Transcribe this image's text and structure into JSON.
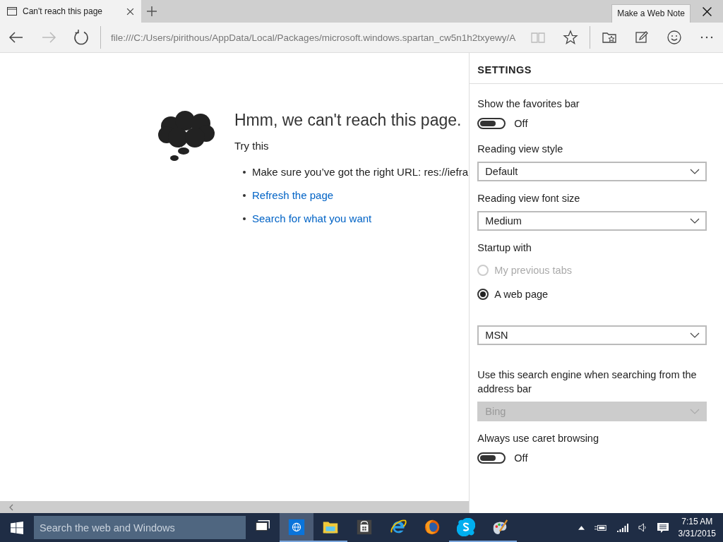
{
  "tabs": [
    {
      "title": "Can't reach this page",
      "selected": true
    }
  ],
  "address_bar": {
    "value": "file:///C:/Users/pirithous/AppData/Local/Packages/microsoft.windows.spartan_cw5n1h2txyewy/A"
  },
  "tooltip": "Make a Web Note",
  "error_page": {
    "heading": "Hmm, we can't reach this page.",
    "subheading": "Try this",
    "items": [
      {
        "kind": "text",
        "text": "Make sure you’ve got the right URL: res://iefra"
      },
      {
        "kind": "link",
        "text": "Refresh the page"
      },
      {
        "kind": "link",
        "text": "Search for what you want"
      }
    ]
  },
  "settings": {
    "title": "SETTINGS",
    "items": [
      {
        "kind": "toggle",
        "label": "Show the favorites bar",
        "on": false,
        "state_text": "Off"
      },
      {
        "kind": "dropdown",
        "label": "Reading view style",
        "value": "Default",
        "disabled": false
      },
      {
        "kind": "dropdown",
        "label": "Reading view font size",
        "value": "Medium",
        "disabled": false
      },
      {
        "kind": "radios",
        "label": "Startup with",
        "options": [
          {
            "label": "My previous tabs",
            "selected": false,
            "disabled": true
          },
          {
            "label": "A web page",
            "selected": true,
            "disabled": false
          }
        ]
      },
      {
        "kind": "dropdown",
        "value": "MSN",
        "disabled": false
      },
      {
        "kind": "dropdown",
        "label": "Use this search engine when searching from the address bar",
        "value": "Bing",
        "disabled": true
      },
      {
        "kind": "toggle",
        "label": "Always use caret browsing",
        "on": false,
        "state_text": "Off"
      }
    ]
  },
  "taskbar": {
    "search_placeholder": "Search the web and Windows",
    "apps": [
      {
        "kind": "taskview",
        "running": false,
        "selected": false
      },
      {
        "kind": "edge",
        "running": true,
        "selected": true
      },
      {
        "kind": "explorer",
        "running": true,
        "selected": false
      },
      {
        "kind": "store",
        "running": false,
        "selected": false
      },
      {
        "kind": "ie",
        "running": false,
        "selected": false
      },
      {
        "kind": "firefox",
        "running": false,
        "selected": false
      },
      {
        "kind": "skype",
        "running": true,
        "selected": false
      },
      {
        "kind": "paint",
        "running": true,
        "selected": false
      }
    ],
    "time": "7:15 AM",
    "date": "3/31/2015"
  }
}
